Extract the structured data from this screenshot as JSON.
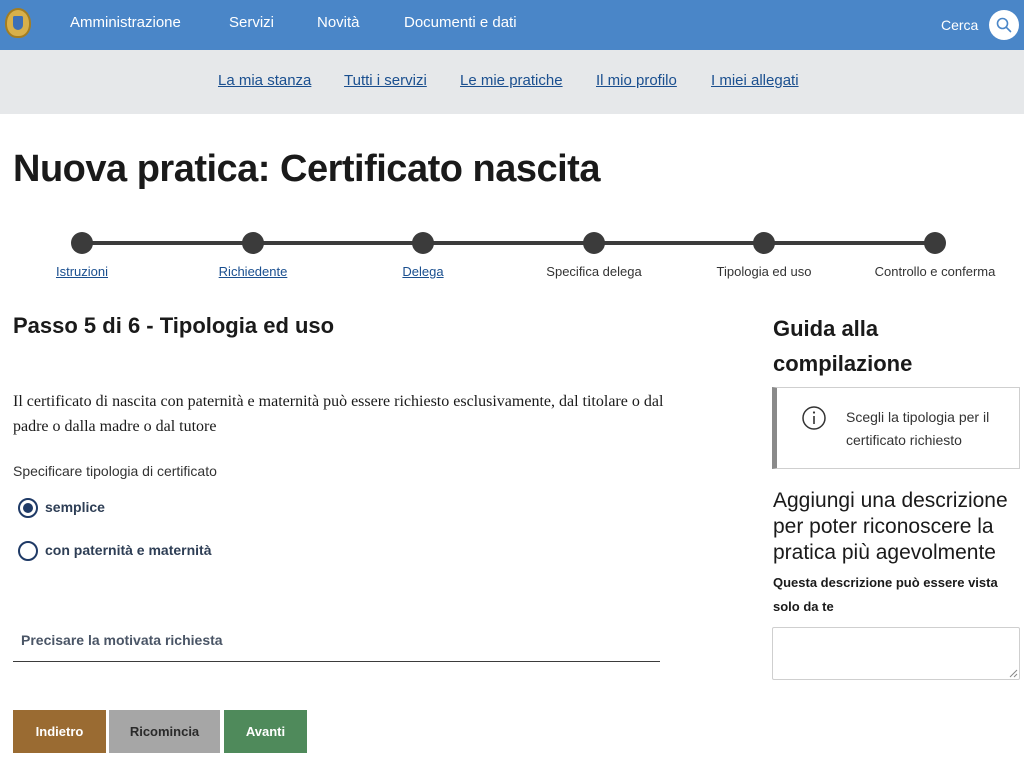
{
  "topnav": {
    "items": [
      "Amministrazione",
      "Servizi",
      "Novità",
      "Documenti e dati"
    ],
    "search_label": "Cerca"
  },
  "subnav": {
    "items": [
      "La mia stanza",
      "Tutti i servizi",
      "Le mie pratiche",
      "Il mio profilo",
      "I miei allegati"
    ]
  },
  "page": {
    "title": "Nuova pratica: Certificato nascita"
  },
  "stepper": {
    "steps": [
      "Istruzioni",
      "Richiedente",
      "Delega",
      "Specifica delega",
      "Tipologia ed uso",
      "Controllo e conferma"
    ]
  },
  "form": {
    "step_heading": "Passo 5 di 6 - Tipologia ed uso",
    "intro": "Il certificato di nascita con paternità e maternità può essere richiesto esclusivamente, dal titolare o dal padre o dalla madre o dal tutore",
    "type_label": "Specificare tipologia di certificato",
    "options": [
      "semplice",
      "con paternità e maternità"
    ],
    "selected_option": "semplice",
    "motivation_label": "Precisare la motivata richiesta"
  },
  "buttons": {
    "back": "Indietro",
    "restart": "Ricomincia",
    "next": "Avanti"
  },
  "sidebar": {
    "guide_title": "Guida alla compilazione",
    "guide_text": "Scegli la tipologia per il certificato richiesto",
    "desc_title": "Aggiungi una descrizione per poter riconoscere la pratica più agevolmente",
    "desc_subtitle": "Questa descrizione può essere vista solo da te"
  },
  "colors": {
    "topbar": "#4a86c8",
    "subnav": "#e6e8ea",
    "link": "#1a4f8f",
    "btn_back": "#9a6b32",
    "btn_restart": "#a6a6a6",
    "btn_next": "#4f8a5b",
    "radio": "#1f3a66"
  }
}
